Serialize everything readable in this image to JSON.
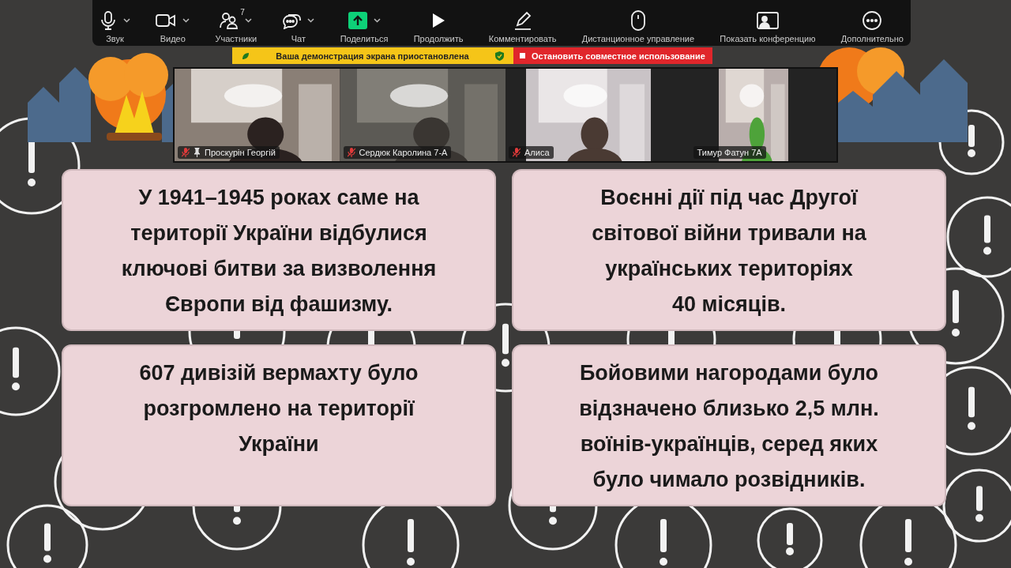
{
  "toolbar": {
    "items": [
      {
        "kind": "mic",
        "label": "Звук",
        "menu": true
      },
      {
        "kind": "video",
        "label": "Видео",
        "menu": true
      },
      {
        "kind": "participants",
        "label": "Участники",
        "menu": true,
        "badge": "7"
      },
      {
        "kind": "chat",
        "label": "Чат",
        "menu": true
      },
      {
        "kind": "share",
        "label": "Поделиться",
        "menu": true
      },
      {
        "kind": "resume",
        "label": "Продолжить",
        "menu": false
      },
      {
        "kind": "annotate",
        "label": "Комментировать",
        "menu": false
      },
      {
        "kind": "remote",
        "label": "Дистанционное управление",
        "menu": false
      },
      {
        "kind": "show",
        "label": "Показать конференцию",
        "menu": false
      },
      {
        "kind": "more",
        "label": "Дополнительно",
        "menu": false
      }
    ]
  },
  "share_banner": {
    "status": "Ваша демонстрация экрана приостановлена",
    "stop": "Остановить совместное использование"
  },
  "participants": [
    {
      "name": "Проскурін Георгій",
      "muted": true,
      "pinned": true
    },
    {
      "name": "Сердюк Каролина 7-А",
      "muted": true,
      "pinned": false
    },
    {
      "name": "Алиса",
      "muted": true,
      "pinned": false
    },
    {
      "name": "Тимур Фатун 7А",
      "muted": false,
      "pinned": false
    }
  ],
  "slide": {
    "cards": [
      {
        "lines": [
          "У 1941–1945 роках саме на",
          "території України відбулися",
          "ключові битви за визволення",
          "Європи від фашизму."
        ]
      },
      {
        "lines": [
          "Воєнні дії під час Другої",
          "світової війни тривали на",
          "українських територіях",
          "40 місяців."
        ]
      },
      {
        "lines": [
          "607 дивізій вермахту було",
          "розгромлено на території",
          "України"
        ]
      },
      {
        "lines": [
          "Бойовими нагородами було",
          "відзначено близько 2,5 млн.",
          "воїнів-українців, серед яких",
          "було чимало розвідників."
        ]
      }
    ]
  }
}
